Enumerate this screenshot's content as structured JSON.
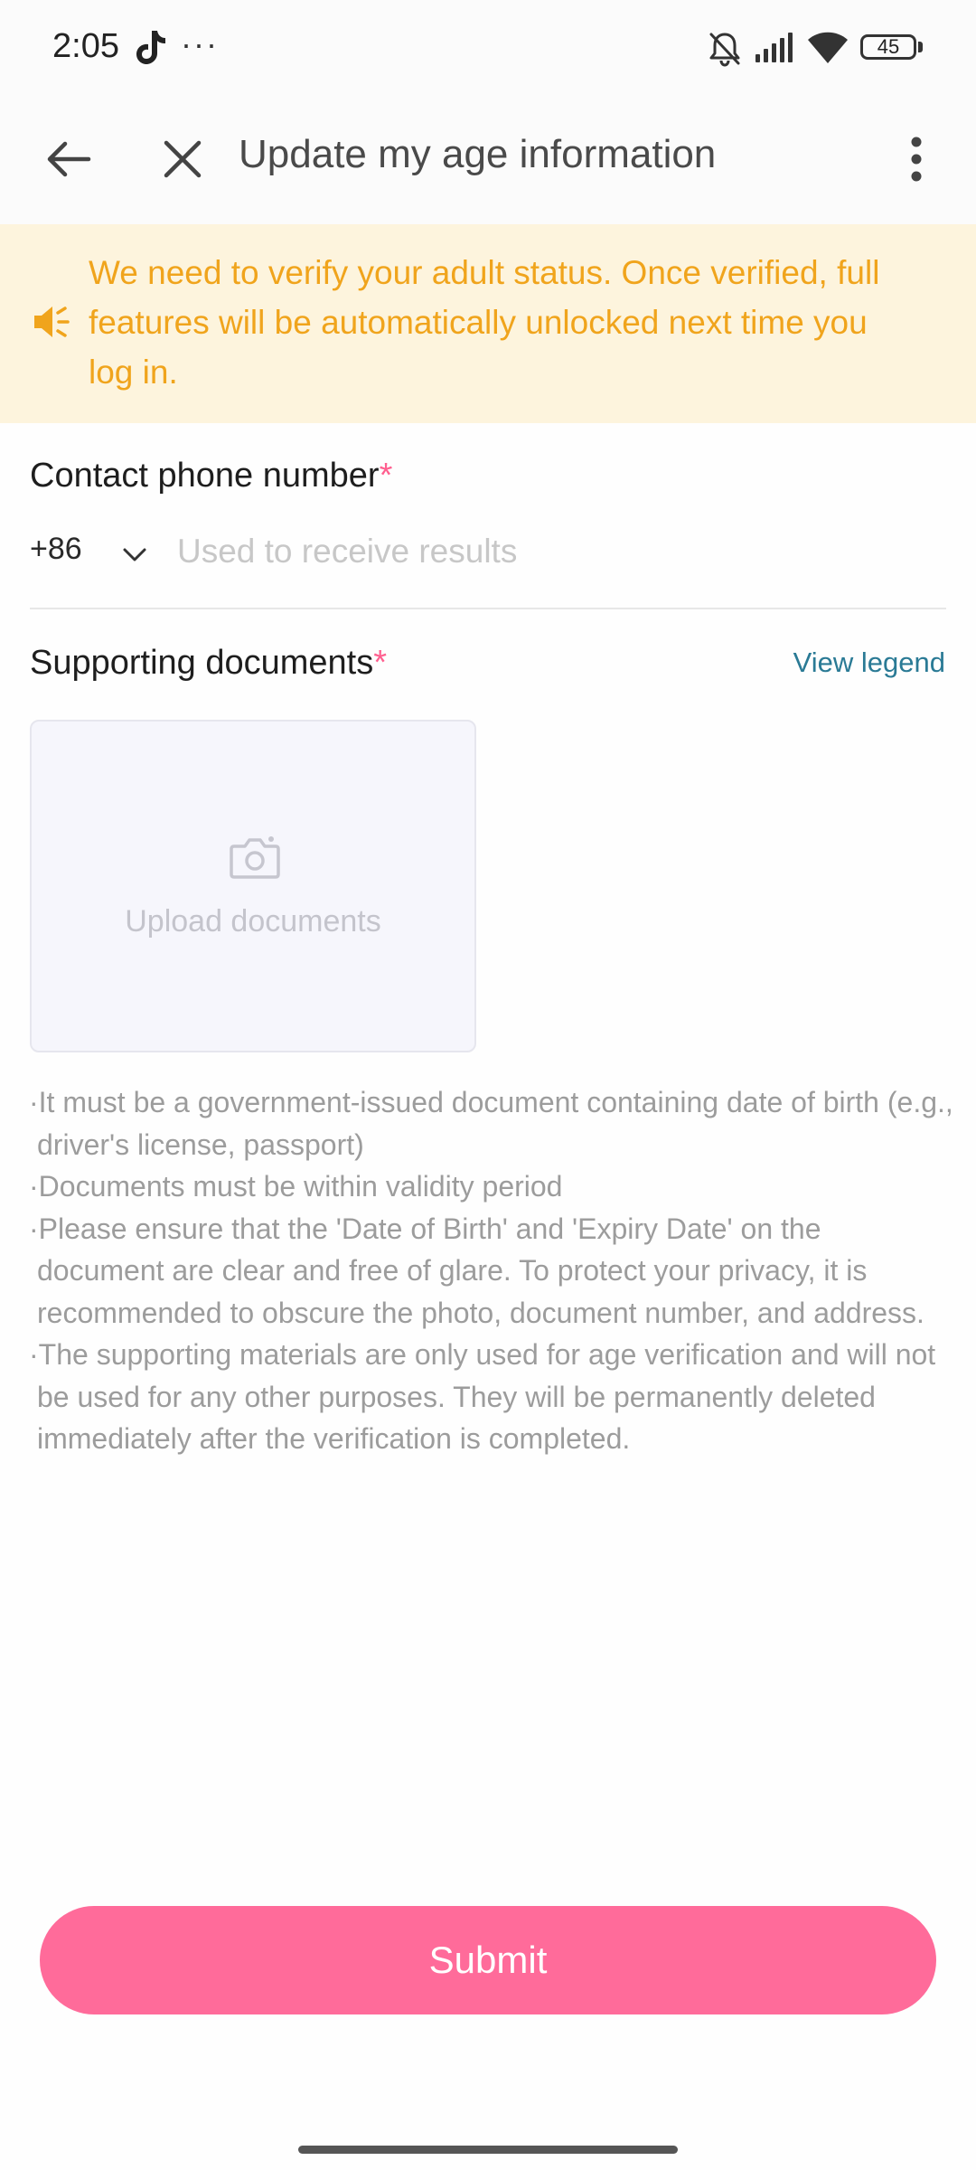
{
  "status_bar": {
    "time": "2:05",
    "more": "···",
    "battery": "45",
    "icons": [
      "tiktok-icon",
      "bell-muted-icon",
      "signal-icon",
      "wifi-icon",
      "battery-icon"
    ]
  },
  "header": {
    "title": "Update my age information",
    "icons": [
      "back-arrow-icon",
      "close-icon",
      "more-vertical-icon"
    ]
  },
  "notice": {
    "text": "We need to verify your adult status. Once verified, full features will be automatically unlocked next time you log in.",
    "icon": "speaker-icon"
  },
  "phone": {
    "label": "Contact phone number",
    "required_mark": "*",
    "country_code": "+86",
    "placeholder": "Used to receive results",
    "value": ""
  },
  "documents": {
    "label": "Supporting documents",
    "required_mark": "*",
    "view_legend": "View legend",
    "upload_label": "Upload documents",
    "notes": [
      "·It must be a government-issued document containing date of birth (e.g., driver's license, passport)",
      "·Documents must be within validity period",
      "·Please ensure that the 'Date of Birth' and 'Expiry Date' on the document are clear and free of glare. To protect your privacy, it is recommended to obscure the photo, document number, and address.",
      "·The supporting materials are only used for age verification and will not be used for any other purposes. They will be permanently deleted immediately after the verification is completed."
    ]
  },
  "submit": {
    "label": "Submit"
  },
  "colors": {
    "accent_pink": "#ff6b9a",
    "notice_bg": "#fdf4dd",
    "notice_text": "#f0a41c",
    "link": "#2a7a95"
  }
}
